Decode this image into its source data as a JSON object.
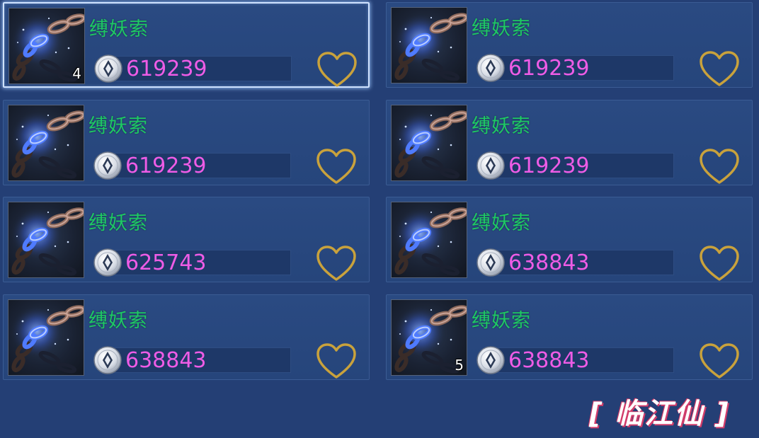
{
  "items": [
    {
      "name": "缚妖索",
      "price": "619239",
      "count": "4",
      "selected": true
    },
    {
      "name": "缚妖索",
      "price": "619239",
      "count": "",
      "selected": false
    },
    {
      "name": "缚妖索",
      "price": "619239",
      "count": "",
      "selected": false
    },
    {
      "name": "缚妖索",
      "price": "619239",
      "count": "",
      "selected": false
    },
    {
      "name": "缚妖索",
      "price": "625743",
      "count": "",
      "selected": false
    },
    {
      "name": "缚妖索",
      "price": "638843",
      "count": "",
      "selected": false
    },
    {
      "name": "缚妖索",
      "price": "638843",
      "count": "",
      "selected": false
    },
    {
      "name": "缚妖索",
      "price": "638843",
      "count": "5",
      "selected": false
    }
  ],
  "watermark": "[ 临江仙 ]",
  "colors": {
    "background": "#243f75",
    "name": "#1ec864",
    "price": "#ee5ce6",
    "heart": "#c9a23c",
    "selected_border": "#cfe2ff"
  },
  "icons": {
    "item": "chain-icon",
    "currency": "silver-coin-icon",
    "favorite": "heart-outline-icon"
  }
}
